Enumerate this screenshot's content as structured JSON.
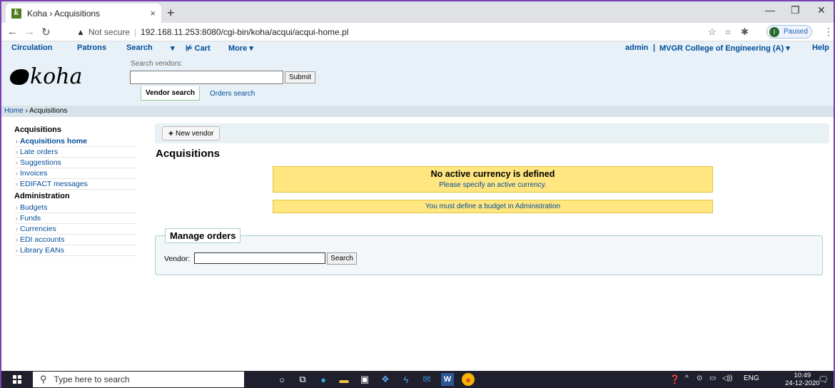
{
  "browser": {
    "tab_title": "Koha › Acquisitions",
    "tab_close": "×",
    "new_tab": "+",
    "favicon_letter": "k",
    "not_secure": "Not secure",
    "url": "192.168.11.253:8080/cgi-bin/koha/acqui/acqui-home.pl",
    "profile_initial": "I",
    "profile_status": "Paused"
  },
  "topnav": {
    "circulation": "Circulation",
    "patrons": "Patrons",
    "search": "Search",
    "cart": "Cart",
    "more": "More",
    "user": "admin",
    "branch": "MVGR College of Engineering (A)",
    "help": "Help"
  },
  "header": {
    "logo_text": "koha",
    "search_label": "Search vendors:",
    "search_value": "",
    "submit_label": "Submit",
    "tab_vendor": "Vendor search",
    "tab_orders": "Orders search"
  },
  "breadcrumb": {
    "home": "Home",
    "sep": "›",
    "current": "Acquisitions"
  },
  "leftmenu": {
    "section1": "Acquisitions",
    "items1": [
      "Acquisitions home",
      "Late orders",
      "Suggestions",
      "Invoices",
      "EDIFACT messages"
    ],
    "section2": "Administration",
    "items2": [
      "Budgets",
      "Funds",
      "Currencies",
      "EDI accounts",
      "Library EANs"
    ]
  },
  "main": {
    "new_vendor": "New vendor",
    "title": "Acquisitions",
    "alert_currency_title": "No active currency is defined",
    "alert_currency_text": "Please specify an active currency.",
    "alert_budget": "You must define a budget in Administration",
    "manage_orders": "Manage orders",
    "vendor_label": "Vendor:",
    "vendor_value": "",
    "search_button": "Search"
  },
  "taskbar": {
    "search_placeholder": "Type here to search",
    "lang": "ENG",
    "time": "10:49",
    "date": "24-12-2020",
    "notif_count": "2"
  },
  "colors": {
    "link": "#004d99",
    "alert_bg": "#ffe680",
    "header_bg": "#e8f1f7",
    "taskbar": "#1f1f2e",
    "frame": "#7a3fb5"
  }
}
